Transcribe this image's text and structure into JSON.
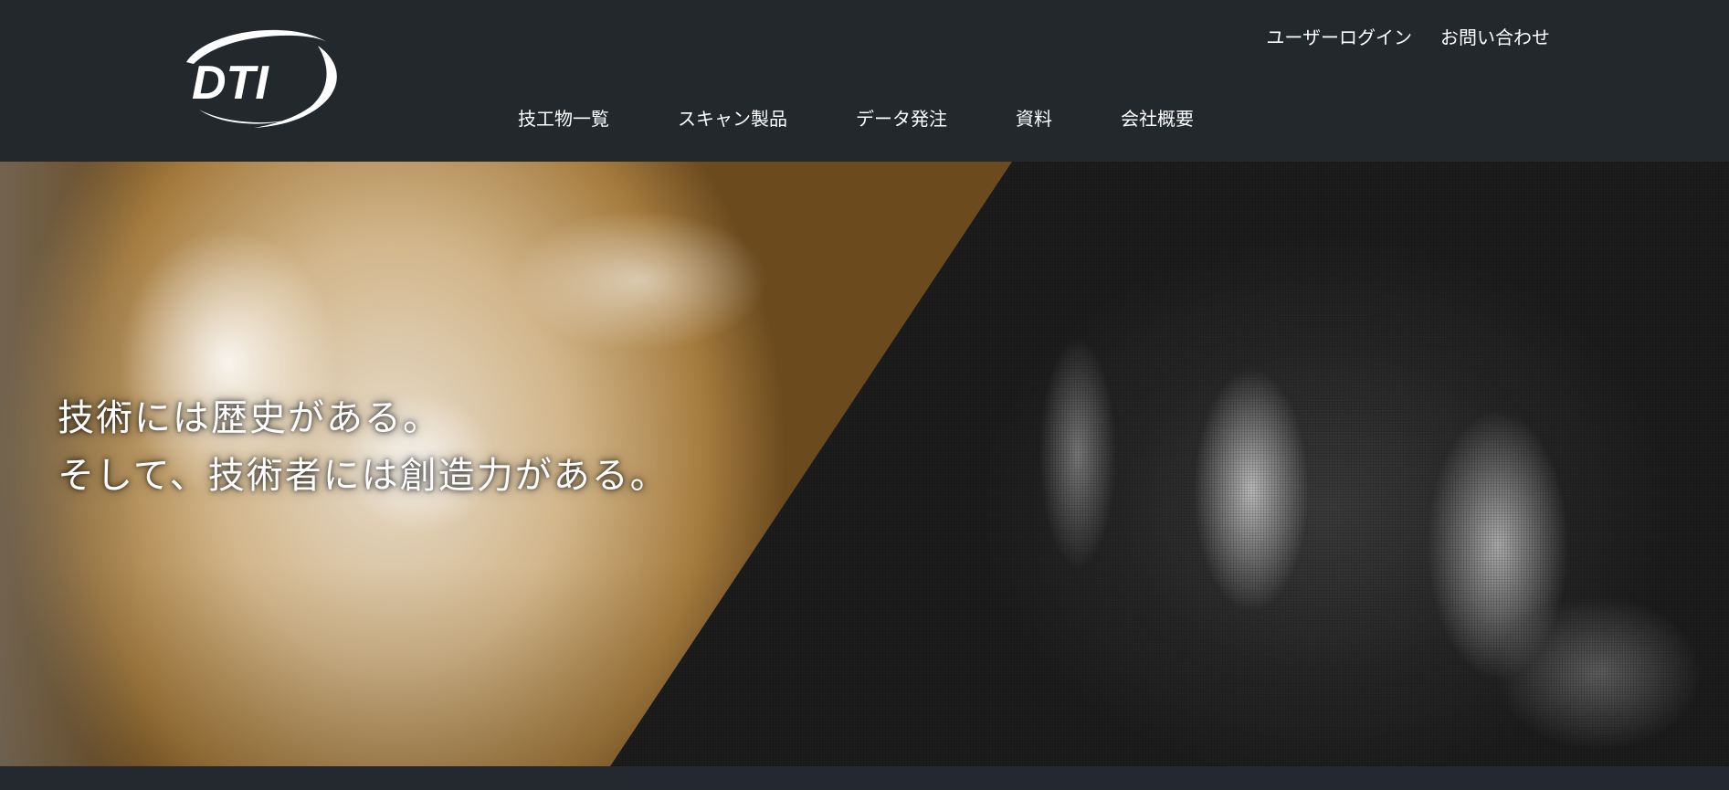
{
  "header": {
    "logo_text": "DTI",
    "utility_links": [
      {
        "label": "ユーザーログイン"
      },
      {
        "label": "お問い合わせ"
      }
    ],
    "main_nav": [
      {
        "label": "技工物一覧"
      },
      {
        "label": "スキャン製品"
      },
      {
        "label": "データ発注"
      },
      {
        "label": "資料"
      },
      {
        "label": "会社概要"
      }
    ]
  },
  "hero": {
    "headline_line1": "技術には歴史がある。",
    "headline_line2": "そして、技術者には創造力がある。"
  },
  "colors": {
    "header_bg": "#23282d",
    "text": "#ffffff",
    "page_bg": "#23272c"
  }
}
